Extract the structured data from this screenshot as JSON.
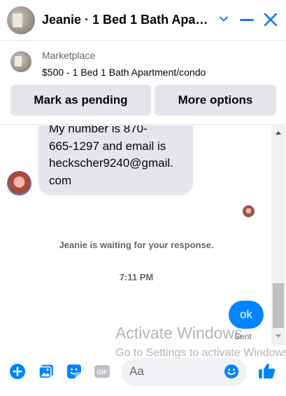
{
  "header": {
    "title": "Jeanie · 1 Bed 1 Bath Apart…",
    "chevron_icon": "chevron-down-icon",
    "minimize_icon": "minimize-icon",
    "close_icon": "close-icon",
    "accent_color": "#1877f2"
  },
  "marketplace": {
    "label": "Marketplace",
    "item": "$500 - 1 Bed 1 Bath Apartment/condo",
    "mark_pending_label": "Mark as pending",
    "more_options_label": "More options"
  },
  "messages": {
    "incoming_lines": [
      "My number is 870-",
      "665-1297 and email is",
      "heckscher9240@gmail.",
      "com"
    ],
    "waiting_text": "Jeanie is waiting for your response.",
    "timestamp": "7:11 PM",
    "outgoing_text": "ok",
    "status": "Sent",
    "outgoing_color": "#0084ff"
  },
  "watermark": {
    "line1": "Activate Windows",
    "line2": "Go to Settings to activate Windows."
  },
  "composer": {
    "placeholder": "Aa",
    "icons": [
      "plus-icon",
      "photo-icon",
      "sticker-icon",
      "gif-icon",
      "emoji-icon",
      "like-icon"
    ],
    "gif_label": "GIF"
  }
}
